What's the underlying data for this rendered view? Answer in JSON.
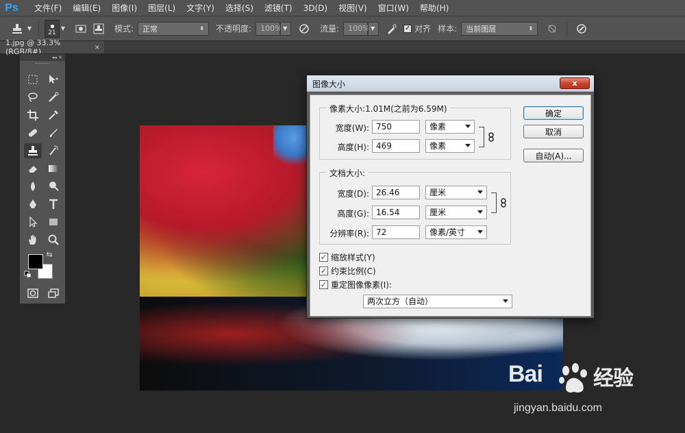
{
  "app": {
    "logo": "Ps"
  },
  "menu": [
    "文件(F)",
    "编辑(E)",
    "图像(I)",
    "图层(L)",
    "文字(Y)",
    "选择(S)",
    "滤镜(T)",
    "3D(D)",
    "视图(V)",
    "窗口(W)",
    "帮助(H)"
  ],
  "options": {
    "brush_size": "21",
    "mode_label": "模式:",
    "mode_value": "正常",
    "opacity_label": "不透明度:",
    "opacity_value": "100%",
    "flow_label": "流量:",
    "flow_value": "100%",
    "align_label": "对齐",
    "sample_label": "样本:",
    "sample_value": "当前图层"
  },
  "document_tab": {
    "title": "1.jpg @ 33.3%(RGB/8#)",
    "close": "×"
  },
  "dialog": {
    "title": "图像大小",
    "close": "x",
    "pixel_size_title": "像素大小:1.01M(之前为6.59M)",
    "width_label": "宽度(W):",
    "width_value": "750",
    "width_unit": "像素",
    "height_label": "高度(H):",
    "height_value": "469",
    "height_unit": "像素",
    "doc_size_title": "文档大小:",
    "doc_width_label": "宽度(D):",
    "doc_width_value": "26.46",
    "doc_width_unit": "厘米",
    "doc_height_label": "高度(G):",
    "doc_height_value": "16.54",
    "doc_height_unit": "厘米",
    "resolution_label": "分辨率(R):",
    "resolution_value": "72",
    "resolution_unit": "像素/英寸",
    "scale_styles": "缩放样式(Y)",
    "constrain": "约束比例(C)",
    "resample": "重定图像像素(I):",
    "resample_method": "两次立方（自动）",
    "ok": "确定",
    "cancel": "取消",
    "auto": "自动(A)..."
  },
  "watermark": {
    "logo_left": "Bai",
    "logo_right": "经验",
    "url": "jingyan.baidu.com"
  },
  "colors": {
    "foreground": "#000000",
    "background": "#ffffff",
    "ps_blue": "#31a8ff"
  }
}
